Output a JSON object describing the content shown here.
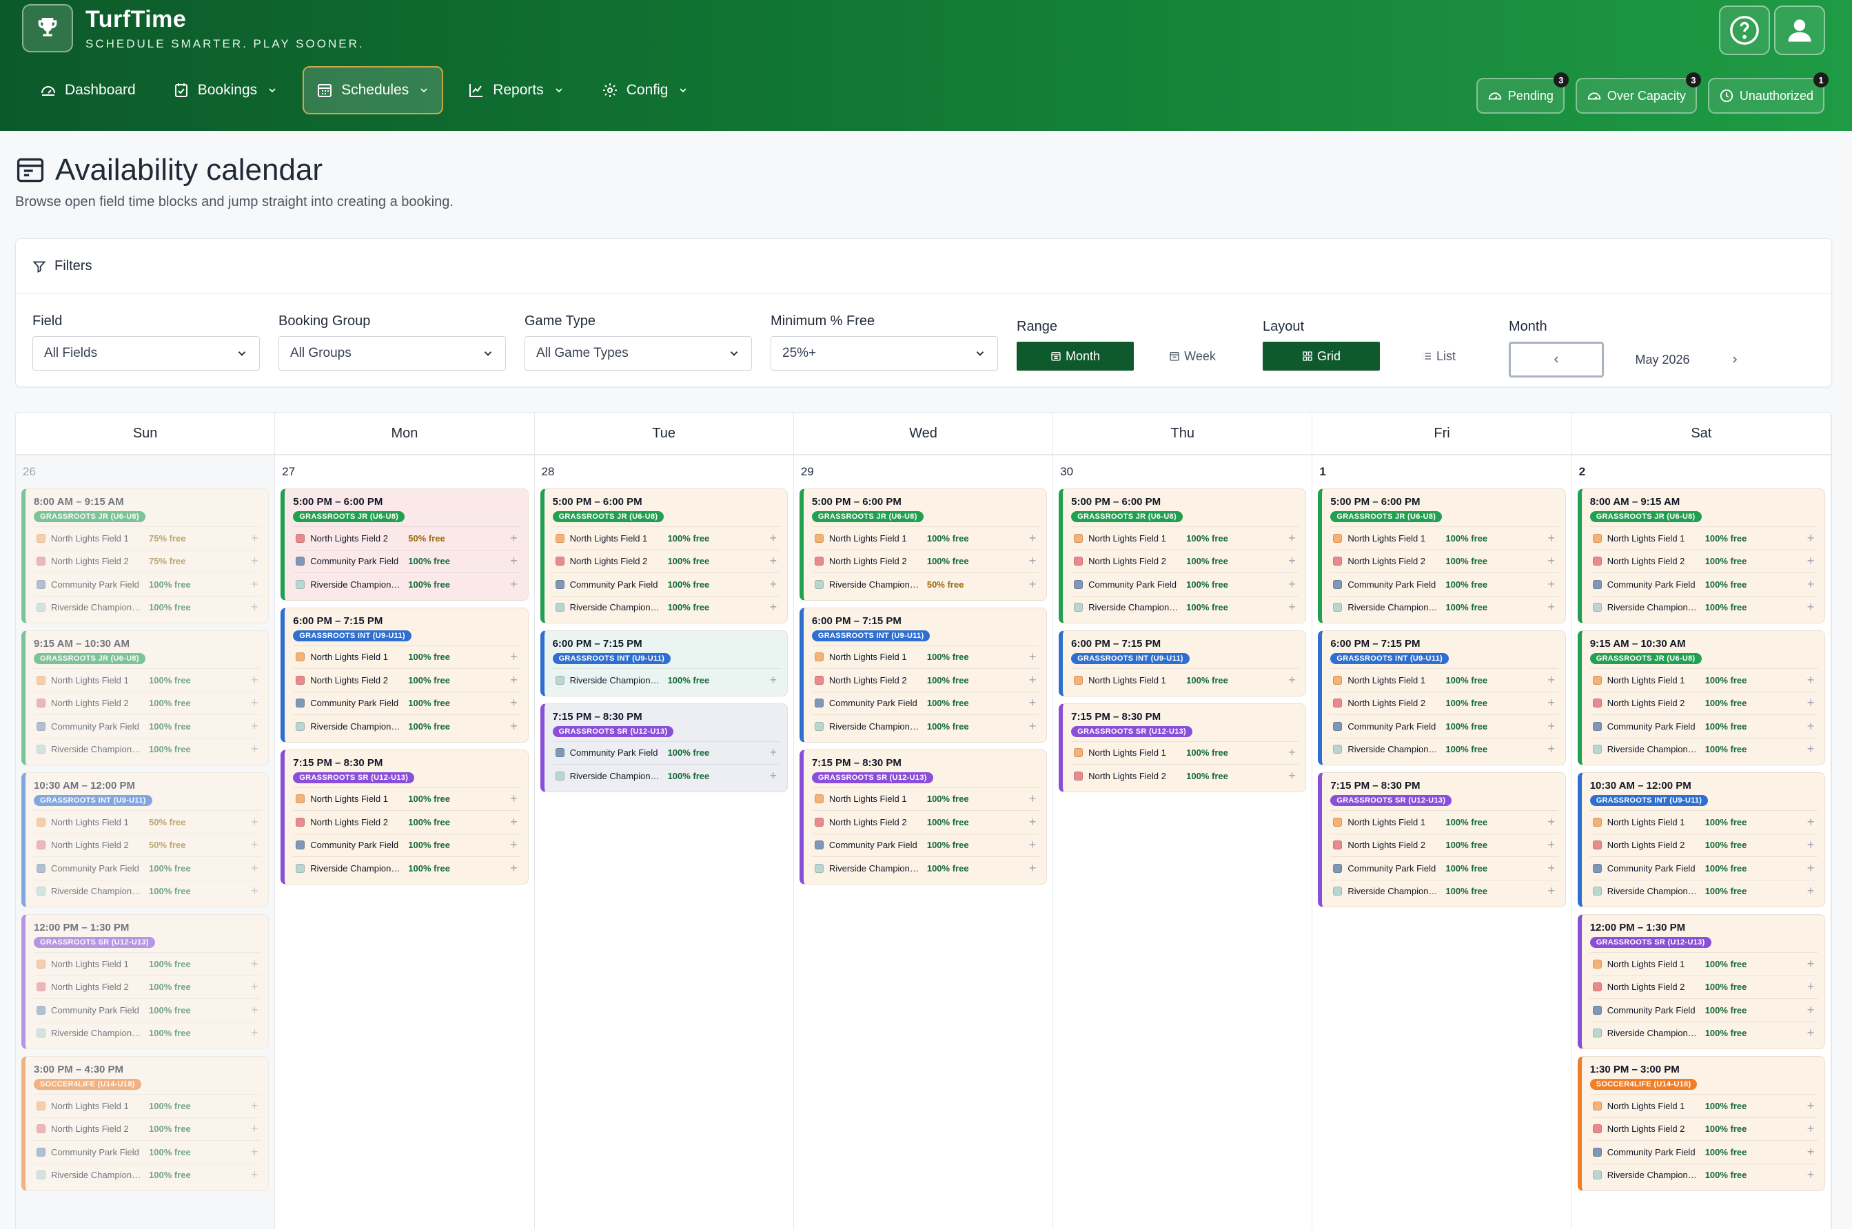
{
  "app": {
    "name": "TurfTime",
    "tagline": "SCHEDULE SMARTER. PLAY SOONER."
  },
  "nav": [
    {
      "label": "Dashboard",
      "icon": "dashboard-icon",
      "dropdown": false,
      "active": false
    },
    {
      "label": "Bookings",
      "icon": "bookings-icon",
      "dropdown": true,
      "active": false
    },
    {
      "label": "Schedules",
      "icon": "calendar-icon",
      "dropdown": true,
      "active": true
    },
    {
      "label": "Reports",
      "icon": "chart-icon",
      "dropdown": true,
      "active": false
    },
    {
      "label": "Config",
      "icon": "gear-icon",
      "dropdown": true,
      "active": false
    }
  ],
  "alerts": [
    {
      "label": "Pending",
      "count": "3",
      "icon": "gauge-icon"
    },
    {
      "label": "Over Capacity",
      "count": "3",
      "icon": "gauge-icon"
    },
    {
      "label": "Unauthorized",
      "count": "1",
      "icon": "clock-icon"
    }
  ],
  "page": {
    "title": "Availability calendar",
    "subtitle": "Browse open field time blocks and jump straight into creating a booking."
  },
  "filters": {
    "heading": "Filters",
    "field": {
      "label": "Field",
      "value": "All Fields"
    },
    "booking_group": {
      "label": "Booking Group",
      "value": "All Groups"
    },
    "game_type": {
      "label": "Game Type",
      "value": "All Game Types"
    },
    "min_free": {
      "label": "Minimum % Free",
      "value": "25%+"
    },
    "range": {
      "label": "Range",
      "options": [
        "Month",
        "Week"
      ],
      "selected": "Month"
    },
    "layout": {
      "label": "Layout",
      "options": [
        "Grid",
        "List"
      ],
      "selected": "Grid"
    },
    "month": {
      "label": "Month",
      "value": "May 2026"
    }
  },
  "colors": {
    "header_start": "#0c5a2a",
    "header_end": "#1f9b45",
    "active_button": "#0f5a2c",
    "field_colors": {
      "North Lights Field 1": "#f6b274",
      "North Lights Field 2": "#e88a8e",
      "Community Park Field": "#7f97b8",
      "Riverside Champions...": "#b9d6d2"
    }
  },
  "calendar": {
    "weekdays": [
      "Sun",
      "Mon",
      "Tue",
      "Wed",
      "Thu",
      "Fri",
      "Sat"
    ],
    "days": [
      {
        "date": "26",
        "past": true,
        "bold": false,
        "slots": [
          {
            "time": "8:00 AM – 9:15 AM",
            "group": "GRASSROOTS JR (U6-U8)",
            "color": "green",
            "bg": "cream",
            "fields": [
              {
                "name": "North Lights Field 1",
                "pct": "75% free"
              },
              {
                "name": "North Lights Field 2",
                "pct": "75% free"
              },
              {
                "name": "Community Park Field",
                "pct": "100% free"
              },
              {
                "name": "Riverside Champions...",
                "pct": "100% free"
              }
            ]
          },
          {
            "time": "9:15 AM – 10:30 AM",
            "group": "GRASSROOTS JR (U6-U8)",
            "color": "green",
            "bg": "cream",
            "fields": [
              {
                "name": "North Lights Field 1",
                "pct": "100% free"
              },
              {
                "name": "North Lights Field 2",
                "pct": "100% free"
              },
              {
                "name": "Community Park Field",
                "pct": "100% free"
              },
              {
                "name": "Riverside Champions...",
                "pct": "100% free"
              }
            ]
          },
          {
            "time": "10:30 AM – 12:00 PM",
            "group": "GRASSROOTS INT (U9-U11)",
            "color": "blue",
            "bg": "cream",
            "fields": [
              {
                "name": "North Lights Field 1",
                "pct": "50% free"
              },
              {
                "name": "North Lights Field 2",
                "pct": "50% free"
              },
              {
                "name": "Community Park Field",
                "pct": "100% free"
              },
              {
                "name": "Riverside Champions...",
                "pct": "100% free"
              }
            ]
          },
          {
            "time": "12:00 PM – 1:30 PM",
            "group": "GRASSROOTS SR (U12-U13)",
            "color": "purple",
            "bg": "cream",
            "fields": [
              {
                "name": "North Lights Field 1",
                "pct": "100% free"
              },
              {
                "name": "North Lights Field 2",
                "pct": "100% free"
              },
              {
                "name": "Community Park Field",
                "pct": "100% free"
              },
              {
                "name": "Riverside Champions...",
                "pct": "100% free"
              }
            ]
          },
          {
            "time": "3:00 PM – 4:30 PM",
            "group": "SOCCER4LIFE (U14-U18)",
            "color": "orange",
            "bg": "cream",
            "fields": [
              {
                "name": "North Lights Field 1",
                "pct": "100% free"
              },
              {
                "name": "North Lights Field 2",
                "pct": "100% free"
              },
              {
                "name": "Community Park Field",
                "pct": "100% free"
              },
              {
                "name": "Riverside Champions...",
                "pct": "100% free"
              }
            ]
          }
        ]
      },
      {
        "date": "27",
        "past": false,
        "bold": false,
        "slots": [
          {
            "time": "5:00 PM – 6:00 PM",
            "group": "GRASSROOTS JR (U6-U8)",
            "color": "green",
            "bg": "pink",
            "fields": [
              {
                "name": "North Lights Field 2",
                "pct": "50% free"
              },
              {
                "name": "Community Park Field",
                "pct": "100% free"
              },
              {
                "name": "Riverside Champions...",
                "pct": "100% free"
              }
            ]
          },
          {
            "time": "6:00 PM – 7:15 PM",
            "group": "GRASSROOTS INT (U9-U11)",
            "color": "blue",
            "bg": "cream",
            "fields": [
              {
                "name": "North Lights Field 1",
                "pct": "100% free"
              },
              {
                "name": "North Lights Field 2",
                "pct": "100% free"
              },
              {
                "name": "Community Park Field",
                "pct": "100% free"
              },
              {
                "name": "Riverside Champions...",
                "pct": "100% free"
              }
            ]
          },
          {
            "time": "7:15 PM – 8:30 PM",
            "group": "GRASSROOTS SR (U12-U13)",
            "color": "purple",
            "bg": "cream",
            "fields": [
              {
                "name": "North Lights Field 1",
                "pct": "100% free"
              },
              {
                "name": "North Lights Field 2",
                "pct": "100% free"
              },
              {
                "name": "Community Park Field",
                "pct": "100% free"
              },
              {
                "name": "Riverside Champions...",
                "pct": "100% free"
              }
            ]
          }
        ]
      },
      {
        "date": "28",
        "past": false,
        "bold": false,
        "slots": [
          {
            "time": "5:00 PM – 6:00 PM",
            "group": "GRASSROOTS JR (U6-U8)",
            "color": "green",
            "bg": "cream",
            "fields": [
              {
                "name": "North Lights Field 1",
                "pct": "100% free"
              },
              {
                "name": "North Lights Field 2",
                "pct": "100% free"
              },
              {
                "name": "Community Park Field",
                "pct": "100% free"
              },
              {
                "name": "Riverside Champions...",
                "pct": "100% free"
              }
            ]
          },
          {
            "time": "6:00 PM – 7:15 PM",
            "group": "GRASSROOTS INT (U9-U11)",
            "color": "blue",
            "bg": "mint",
            "fields": [
              {
                "name": "Riverside Champions...",
                "pct": "100% free"
              }
            ]
          },
          {
            "time": "7:15 PM – 8:30 PM",
            "group": "GRASSROOTS SR (U12-U13)",
            "color": "purple",
            "bg": "slate",
            "fields": [
              {
                "name": "Community Park Field",
                "pct": "100% free"
              },
              {
                "name": "Riverside Champions...",
                "pct": "100% free"
              }
            ]
          }
        ]
      },
      {
        "date": "29",
        "past": false,
        "bold": false,
        "slots": [
          {
            "time": "5:00 PM – 6:00 PM",
            "group": "GRASSROOTS JR (U6-U8)",
            "color": "green",
            "bg": "cream",
            "fields": [
              {
                "name": "North Lights Field 1",
                "pct": "100% free"
              },
              {
                "name": "North Lights Field 2",
                "pct": "100% free"
              },
              {
                "name": "Riverside Champions...",
                "pct": "50% free"
              }
            ]
          },
          {
            "time": "6:00 PM – 7:15 PM",
            "group": "GRASSROOTS INT (U9-U11)",
            "color": "blue",
            "bg": "cream",
            "fields": [
              {
                "name": "North Lights Field 1",
                "pct": "100% free"
              },
              {
                "name": "North Lights Field 2",
                "pct": "100% free"
              },
              {
                "name": "Community Park Field",
                "pct": "100% free"
              },
              {
                "name": "Riverside Champions...",
                "pct": "100% free"
              }
            ]
          },
          {
            "time": "7:15 PM – 8:30 PM",
            "group": "GRASSROOTS SR (U12-U13)",
            "color": "purple",
            "bg": "cream",
            "fields": [
              {
                "name": "North Lights Field 1",
                "pct": "100% free"
              },
              {
                "name": "North Lights Field 2",
                "pct": "100% free"
              },
              {
                "name": "Community Park Field",
                "pct": "100% free"
              },
              {
                "name": "Riverside Champions...",
                "pct": "100% free"
              }
            ]
          }
        ]
      },
      {
        "date": "30",
        "past": false,
        "bold": false,
        "slots": [
          {
            "time": "5:00 PM – 6:00 PM",
            "group": "GRASSROOTS JR (U6-U8)",
            "color": "green",
            "bg": "cream",
            "fields": [
              {
                "name": "North Lights Field 1",
                "pct": "100% free"
              },
              {
                "name": "North Lights Field 2",
                "pct": "100% free"
              },
              {
                "name": "Community Park Field",
                "pct": "100% free"
              },
              {
                "name": "Riverside Champions...",
                "pct": "100% free"
              }
            ]
          },
          {
            "time": "6:00 PM – 7:15 PM",
            "group": "GRASSROOTS INT (U9-U11)",
            "color": "blue",
            "bg": "cream",
            "fields": [
              {
                "name": "North Lights Field 1",
                "pct": "100% free"
              }
            ]
          },
          {
            "time": "7:15 PM – 8:30 PM",
            "group": "GRASSROOTS SR (U12-U13)",
            "color": "purple",
            "bg": "cream",
            "fields": [
              {
                "name": "North Lights Field 1",
                "pct": "100% free"
              },
              {
                "name": "North Lights Field 2",
                "pct": "100% free"
              }
            ]
          }
        ]
      },
      {
        "date": "1",
        "past": false,
        "bold": true,
        "slots": [
          {
            "time": "5:00 PM – 6:00 PM",
            "group": "GRASSROOTS JR (U6-U8)",
            "color": "green",
            "bg": "cream",
            "fields": [
              {
                "name": "North Lights Field 1",
                "pct": "100% free"
              },
              {
                "name": "North Lights Field 2",
                "pct": "100% free"
              },
              {
                "name": "Community Park Field",
                "pct": "100% free"
              },
              {
                "name": "Riverside Champions...",
                "pct": "100% free"
              }
            ]
          },
          {
            "time": "6:00 PM – 7:15 PM",
            "group": "GRASSROOTS INT (U9-U11)",
            "color": "blue",
            "bg": "cream",
            "fields": [
              {
                "name": "North Lights Field 1",
                "pct": "100% free"
              },
              {
                "name": "North Lights Field 2",
                "pct": "100% free"
              },
              {
                "name": "Community Park Field",
                "pct": "100% free"
              },
              {
                "name": "Riverside Champions...",
                "pct": "100% free"
              }
            ]
          },
          {
            "time": "7:15 PM – 8:30 PM",
            "group": "GRASSROOTS SR (U12-U13)",
            "color": "purple",
            "bg": "cream",
            "fields": [
              {
                "name": "North Lights Field 1",
                "pct": "100% free"
              },
              {
                "name": "North Lights Field 2",
                "pct": "100% free"
              },
              {
                "name": "Community Park Field",
                "pct": "100% free"
              },
              {
                "name": "Riverside Champions...",
                "pct": "100% free"
              }
            ]
          }
        ]
      },
      {
        "date": "2",
        "past": false,
        "bold": true,
        "slots": [
          {
            "time": "8:00 AM – 9:15 AM",
            "group": "GRASSROOTS JR (U6-U8)",
            "color": "green",
            "bg": "cream",
            "fields": [
              {
                "name": "North Lights Field 1",
                "pct": "100% free"
              },
              {
                "name": "North Lights Field 2",
                "pct": "100% free"
              },
              {
                "name": "Community Park Field",
                "pct": "100% free"
              },
              {
                "name": "Riverside Champions...",
                "pct": "100% free"
              }
            ]
          },
          {
            "time": "9:15 AM – 10:30 AM",
            "group": "GRASSROOTS JR (U6-U8)",
            "color": "green",
            "bg": "cream",
            "fields": [
              {
                "name": "North Lights Field 1",
                "pct": "100% free"
              },
              {
                "name": "North Lights Field 2",
                "pct": "100% free"
              },
              {
                "name": "Community Park Field",
                "pct": "100% free"
              },
              {
                "name": "Riverside Champions...",
                "pct": "100% free"
              }
            ]
          },
          {
            "time": "10:30 AM – 12:00 PM",
            "group": "GRASSROOTS INT (U9-U11)",
            "color": "blue",
            "bg": "cream",
            "fields": [
              {
                "name": "North Lights Field 1",
                "pct": "100% free"
              },
              {
                "name": "North Lights Field 2",
                "pct": "100% free"
              },
              {
                "name": "Community Park Field",
                "pct": "100% free"
              },
              {
                "name": "Riverside Champions...",
                "pct": "100% free"
              }
            ]
          },
          {
            "time": "12:00 PM – 1:30 PM",
            "group": "GRASSROOTS SR (U12-U13)",
            "color": "purple",
            "bg": "cream",
            "fields": [
              {
                "name": "North Lights Field 1",
                "pct": "100% free"
              },
              {
                "name": "North Lights Field 2",
                "pct": "100% free"
              },
              {
                "name": "Community Park Field",
                "pct": "100% free"
              },
              {
                "name": "Riverside Champions...",
                "pct": "100% free"
              }
            ]
          },
          {
            "time": "1:30 PM – 3:00 PM",
            "group": "SOCCER4LIFE (U14-U18)",
            "color": "orange",
            "bg": "cream",
            "fields": [
              {
                "name": "North Lights Field 1",
                "pct": "100% free"
              },
              {
                "name": "North Lights Field 2",
                "pct": "100% free"
              },
              {
                "name": "Community Park Field",
                "pct": "100% free"
              },
              {
                "name": "Riverside Champions...",
                "pct": "100% free"
              }
            ]
          }
        ]
      }
    ]
  }
}
